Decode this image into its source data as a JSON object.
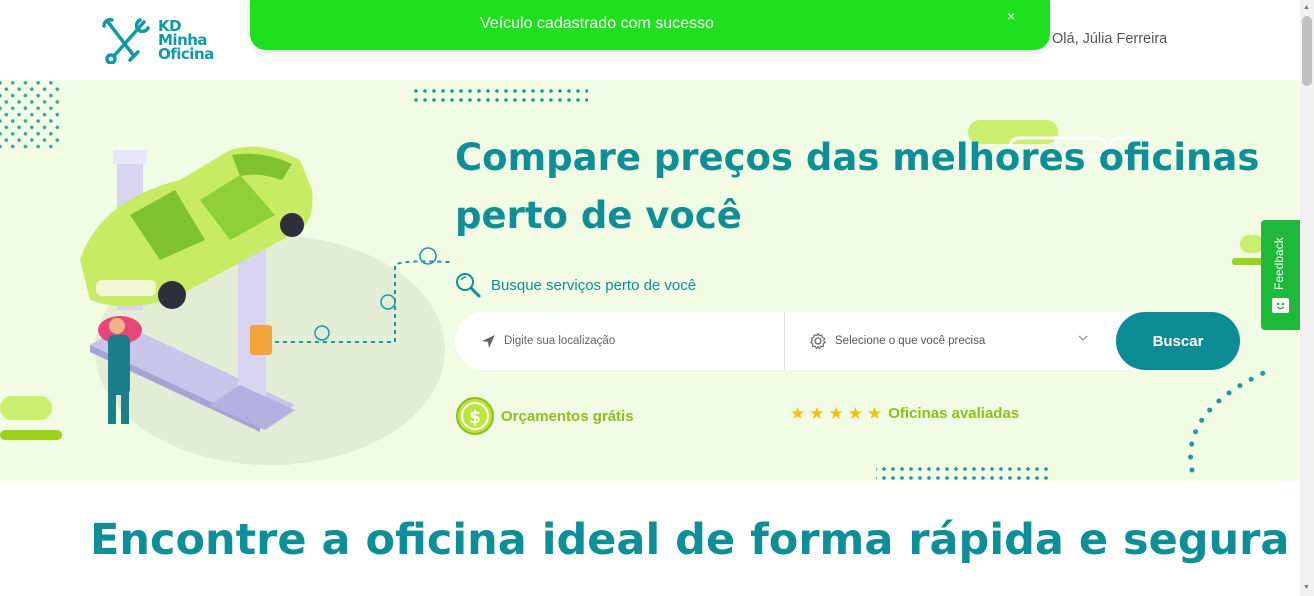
{
  "header": {
    "logo_line1": "KD",
    "logo_line2": "Minha",
    "logo_line3": "Oficina",
    "user_greeting": "Olá, Júlia Ferreira"
  },
  "toast": {
    "message": "Veículo cadastrado com sucesso",
    "close_symbol": "×",
    "color": "#1fe01f"
  },
  "hero": {
    "title_line1": "Compare preços das melhores oficinas",
    "title_line2": "perto de você",
    "search_label": "Busque serviços perto de você",
    "location_placeholder": "Digite sua localização",
    "service_select": "Selecione o que você precisa",
    "search_button": "Buscar",
    "feature_quotes": "Orçamentos grátis",
    "feature_rated": "Oficinas avaliadas",
    "stars": 5
  },
  "feedback": {
    "label": "Feedback"
  },
  "section": {
    "title_bold": "Encontre a oficina ideal",
    "title_rest": " de forma rápida e segura"
  },
  "colors": {
    "brand_teal": "#0e8f97",
    "button_teal": "#0d8b96",
    "accent_lime": "#8ac11c",
    "hero_bg": "#f2fbe4",
    "star": "#f2c20f"
  }
}
